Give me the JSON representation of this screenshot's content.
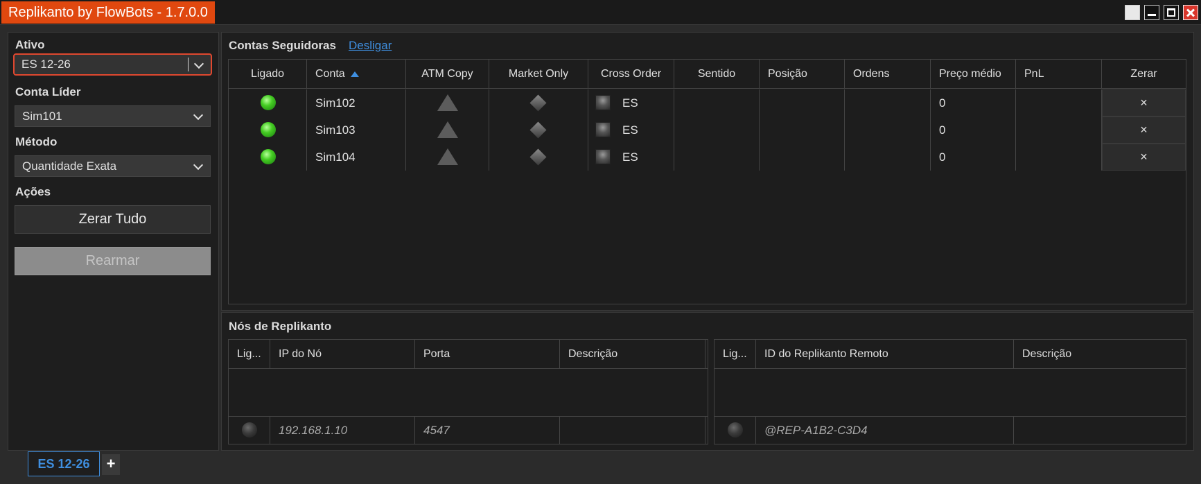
{
  "window": {
    "title": "Replikanto by FlowBots - 1.7.0.0"
  },
  "left": {
    "ativo_label": "Ativo",
    "ativo_value": "ES 12-26",
    "conta_lider_label": "Conta Líder",
    "conta_lider_value": "Sim101",
    "metodo_label": "Método",
    "metodo_value": "Quantidade Exata",
    "acoes_label": "Ações",
    "zerar_tudo_label": "Zerar Tudo",
    "rearmar_label": "Rearmar"
  },
  "followers": {
    "title": "Contas Seguidoras",
    "disconnect_link": "Desligar",
    "columns": [
      "Ligado",
      "Conta",
      "ATM Copy",
      "Market Only",
      "Cross Order",
      "Sentido",
      "Posição",
      "Ordens",
      "Preço médio",
      "PnL",
      "Zerar"
    ],
    "rows": [
      {
        "ligado": "on",
        "conta": "Sim102",
        "cross_order": "ES",
        "sentido": "",
        "posicao": "",
        "ordens": "",
        "preco_medio": "0",
        "pnl": "",
        "zerar": "×"
      },
      {
        "ligado": "on",
        "conta": "Sim103",
        "cross_order": "ES",
        "sentido": "",
        "posicao": "",
        "ordens": "",
        "preco_medio": "0",
        "pnl": "",
        "zerar": "×"
      },
      {
        "ligado": "on",
        "conta": "Sim104",
        "cross_order": "ES",
        "sentido": "",
        "posicao": "",
        "ordens": "",
        "preco_medio": "0",
        "pnl": "",
        "zerar": "×"
      }
    ]
  },
  "nodes": {
    "title": "Nós de Replikanto",
    "left_grid": {
      "columns": [
        "Lig...",
        "IP do Nó",
        "Porta",
        "Descrição"
      ],
      "new_row": {
        "ip": "192.168.1.10",
        "porta": "4547",
        "descricao": ""
      }
    },
    "right_grid": {
      "columns": [
        "Lig...",
        "ID do Replikanto Remoto",
        "Descrição"
      ],
      "new_row": {
        "id": "@REP-A1B2-C3D4",
        "descricao": ""
      }
    }
  },
  "tabs": {
    "active": "ES 12-26",
    "add": "+"
  },
  "colors": {
    "accent": "#e0480f",
    "link": "#3f8fe0",
    "led_on": "#44cc22"
  }
}
